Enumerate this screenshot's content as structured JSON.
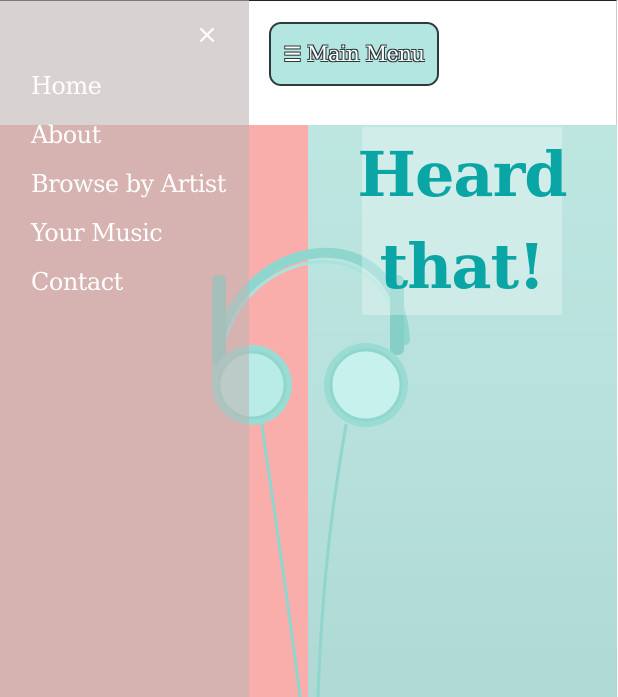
{
  "header": {
    "menu_button": {
      "icon": "hamburger-icon",
      "glyph": "☰",
      "label": "Main Menu"
    }
  },
  "hero": {
    "title_line1": "Heard",
    "title_line2": "that!",
    "colors": {
      "pink": "#f9aeab",
      "mint": "#bde6e1",
      "title": "#0aa5a5",
      "headphones": "#8fd6ce"
    }
  },
  "sidenav": {
    "close_glyph": "×",
    "close_icon": "close-icon",
    "items": [
      {
        "label": "Home"
      },
      {
        "label": "About"
      },
      {
        "label": "Browse by Artist"
      },
      {
        "label": "Your Music"
      },
      {
        "label": "Contact"
      }
    ]
  }
}
